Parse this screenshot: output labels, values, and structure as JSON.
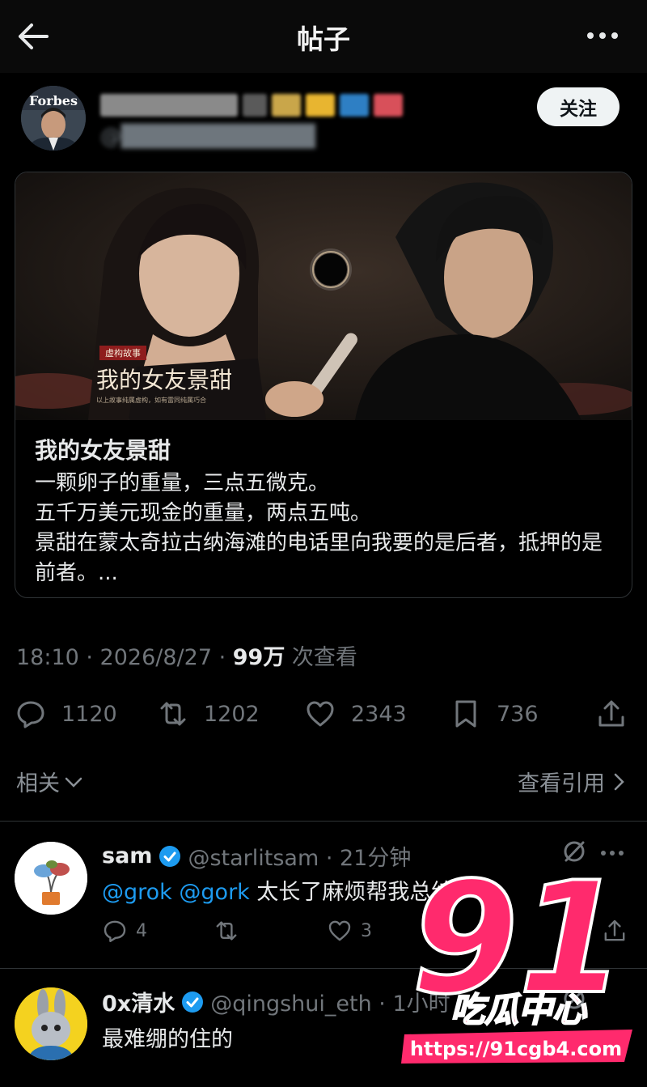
{
  "header": {
    "title": "帖子"
  },
  "author": {
    "follow_label": "关注",
    "avatar_text": "Forbes"
  },
  "card": {
    "image_badge": "虚构故事",
    "image_title": "我的女友景甜",
    "image_caption": "以上故事纯属虚构，如有雷同纯属巧合",
    "title": "我的女友景甜",
    "lines": [
      "一颗卵子的重量，三点五微克。",
      "五千万美元现金的重量，两点五吨。",
      "景甜在蒙太奇拉古纳海滩的电话里向我要的是后者，抵押的是前者。..."
    ]
  },
  "meta": {
    "time": "18:10 · 2026/8/27 · ",
    "views": "99万",
    "views_suffix": " 次查看"
  },
  "stats": {
    "replies": "1120",
    "reposts": "1202",
    "likes": "2343",
    "bookmarks": "736"
  },
  "related": {
    "label": "相关",
    "quotes_label": "查看引用"
  },
  "replies": [
    {
      "name": "sam",
      "handle": "@starlitsam · 21分钟",
      "mentions": [
        "@grok",
        "@gork"
      ],
      "text": " 太长了麻烦帮我总结",
      "reply_count": "4",
      "like_count": "3"
    },
    {
      "name": "0x清水",
      "handle": "@qingshui_eth · 1小时",
      "text": "最难绷的住的"
    }
  ],
  "watermark": {
    "number": "91",
    "label": "吃瓜中心",
    "url": "https://91cgb4.com"
  },
  "colors": {
    "accent": "#1d9bf0",
    "watermark_pink": "#ff2a6d",
    "background": "#000000"
  },
  "icons": [
    "back-arrow-icon",
    "more-icon",
    "reply-icon",
    "repost-icon",
    "like-icon",
    "bookmark-icon",
    "share-icon",
    "verified-icon",
    "grok-icon",
    "chevron-down-icon",
    "chevron-right-icon"
  ]
}
